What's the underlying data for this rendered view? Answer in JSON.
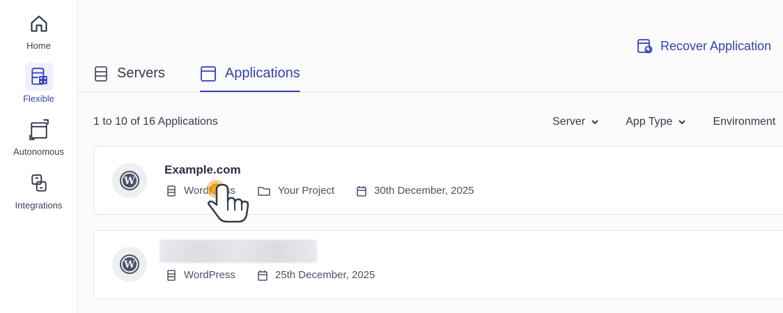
{
  "sidebar": {
    "items": [
      {
        "label": "Home",
        "icon": "home-icon"
      },
      {
        "label": "Flexible",
        "icon": "flexible-icon",
        "active": true
      },
      {
        "label": "Autonomous",
        "icon": "autonomous-icon"
      },
      {
        "label": "Integrations",
        "icon": "integrations-icon"
      }
    ]
  },
  "header": {
    "recover_label": "Recover Application"
  },
  "tabs": [
    {
      "label": "Servers",
      "icon": "server-icon"
    },
    {
      "label": "Applications",
      "icon": "window-icon",
      "active": true
    }
  ],
  "list": {
    "count_text": "1 to 10 of 16 Applications",
    "filters": [
      "Server",
      "App Type",
      "Environment"
    ]
  },
  "applications": [
    {
      "name": "Example.com",
      "type": "WordPress",
      "project": "Your Project",
      "date": "30th December, 2025",
      "logo": "wordpress-icon"
    },
    {
      "name": "",
      "name_blurred": true,
      "type": "WordPress",
      "date": "25th December, 2025",
      "logo": "wordpress-icon"
    }
  ],
  "colors": {
    "accent": "#3540b5",
    "text": "#333a4d",
    "border": "#e3e5ea",
    "cursor_highlight": "#f5a623"
  }
}
